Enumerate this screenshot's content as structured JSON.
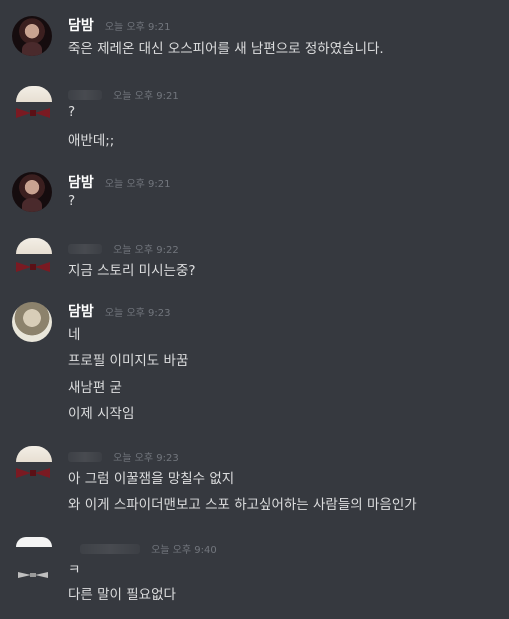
{
  "messages": [
    {
      "author": "담밤",
      "timestamp": "오늘 오후 9:21",
      "lines": [
        "죽은 제레온 대신 오스피어를 새 남편으로 정하였습니다."
      ]
    },
    {
      "author": "",
      "timestamp": "오늘 오후 9:21",
      "lines": [
        "?",
        "애반데;;"
      ]
    },
    {
      "author": "담밤",
      "timestamp": "오늘 오후 9:21",
      "lines": [
        "?"
      ]
    },
    {
      "author": "",
      "timestamp": "오늘 오후 9:22",
      "lines": [
        "지금 스토리 미시는중?"
      ]
    },
    {
      "author": "담밤",
      "timestamp": "오늘 오후 9:23",
      "lines": [
        "네",
        "프로필 이미지도 바꿈",
        "새남편 굳",
        "이제 시작임"
      ]
    },
    {
      "author": "",
      "timestamp": "오늘 오후 9:23",
      "lines": [
        "아 그럼 이꿀잼을 망칠수 없지",
        "와 이게 스파이더맨보고 스포 하고싶어하는 사람들의 마음인가"
      ]
    },
    {
      "author": "",
      "timestamp": "오늘 오후 9:40",
      "lines": [
        "ㅋ",
        "다른 말이 필요없다"
      ]
    }
  ]
}
